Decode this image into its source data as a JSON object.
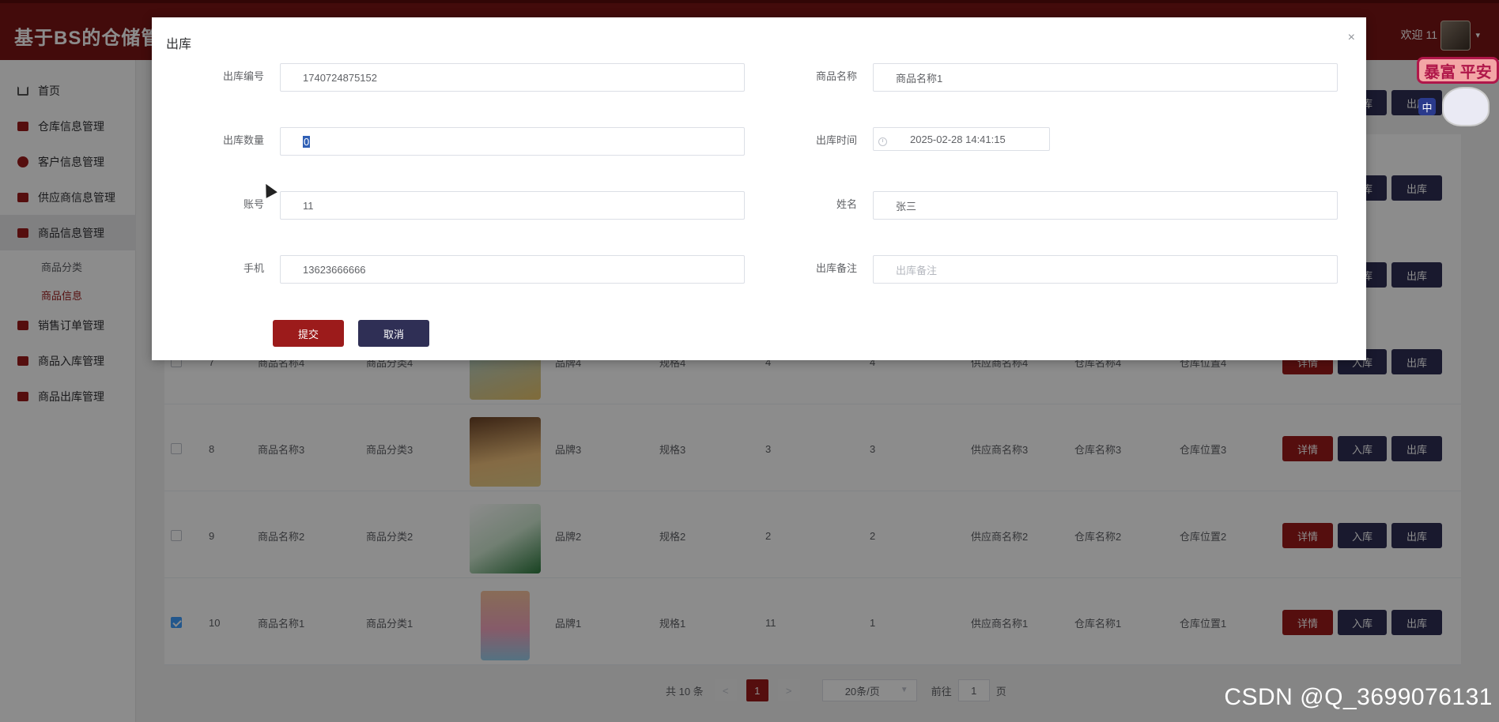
{
  "header": {
    "app_title": "基于BS的仓储管理",
    "welcome_text": "欢迎 11"
  },
  "sidebar": {
    "items": [
      {
        "label": "首页"
      },
      {
        "label": "仓库信息管理"
      },
      {
        "label": "客户信息管理"
      },
      {
        "label": "供应商信息管理"
      },
      {
        "label": "商品信息管理"
      },
      {
        "label": "销售订单管理"
      },
      {
        "label": "商品入库管理"
      },
      {
        "label": "商品出库管理"
      }
    ],
    "sub_items": [
      {
        "label": "商品分类"
      },
      {
        "label": "商品信息"
      }
    ]
  },
  "table": {
    "rows": [
      {
        "id": "7",
        "name": "商品名称4",
        "category": "商品分类4",
        "brand": "品牌4",
        "spec": "规格4",
        "qty_a": "4",
        "qty_b": "4",
        "supplier": "供应商名称4",
        "warehouse": "仓库名称4",
        "location": "仓库位置4",
        "checked": false
      },
      {
        "id": "8",
        "name": "商品名称3",
        "category": "商品分类3",
        "brand": "品牌3",
        "spec": "规格3",
        "qty_a": "3",
        "qty_b": "3",
        "supplier": "供应商名称3",
        "warehouse": "仓库名称3",
        "location": "仓库位置3",
        "checked": false
      },
      {
        "id": "9",
        "name": "商品名称2",
        "category": "商品分类2",
        "brand": "品牌2",
        "spec": "规格2",
        "qty_a": "2",
        "qty_b": "2",
        "supplier": "供应商名称2",
        "warehouse": "仓库名称2",
        "location": "仓库位置2",
        "checked": false
      },
      {
        "id": "10",
        "name": "商品名称1",
        "category": "商品分类1",
        "brand": "品牌1",
        "spec": "规格1",
        "qty_a": "11",
        "qty_b": "1",
        "supplier": "供应商名称1",
        "warehouse": "仓库名称1",
        "location": "仓库位置1",
        "checked": true
      }
    ],
    "actions": {
      "detail": "详情",
      "in": "入库",
      "out": "出库"
    }
  },
  "pagination": {
    "total": "共 10 条",
    "prev": "<",
    "current": "1",
    "next": ">",
    "page_size": "20条/页",
    "goto_label": "前往",
    "goto_value": "1",
    "page_suffix": "页"
  },
  "dialog": {
    "title": "出库",
    "close": "×",
    "fields": {
      "out_no": {
        "label": "出库编号",
        "value": "1740724875152"
      },
      "product_name": {
        "label": "商品名称",
        "value": "商品名称1"
      },
      "out_qty": {
        "label": "出库数量",
        "value": "0"
      },
      "out_time": {
        "label": "出库时间",
        "value": "2025-02-28 14:41:15"
      },
      "account": {
        "label": "账号",
        "value": "11"
      },
      "name": {
        "label": "姓名",
        "value": "张三"
      },
      "phone": {
        "label": "手机",
        "value": "13623666666"
      },
      "remark": {
        "label": "出库备注",
        "placeholder": "出库备注"
      }
    },
    "submit_label": "提交",
    "cancel_label": "取消"
  },
  "sticker": {
    "text": "暴富 平安",
    "char": "中"
  },
  "watermark": "CSDN @Q_3699076131",
  "colors": {
    "brand": "#7a1414",
    "accent": "#9c1b1b",
    "dark_button": "#2f2f55"
  }
}
